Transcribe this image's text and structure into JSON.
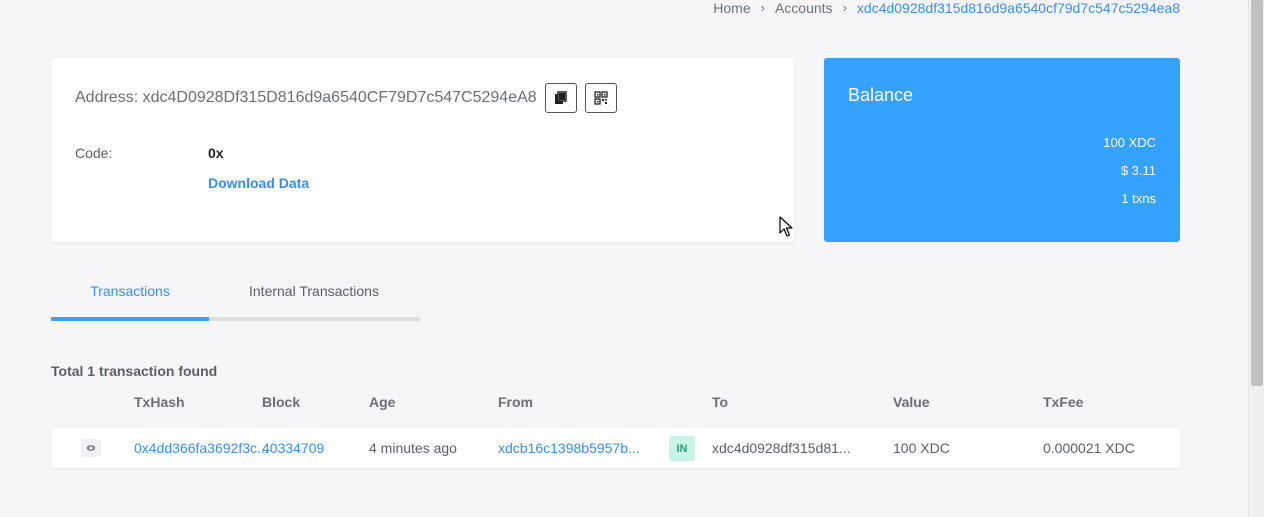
{
  "breadcrumb": {
    "home": "Home",
    "accounts": "Accounts",
    "current": "xdc4d0928df315d816d9a6540cf79d7c547c5294ea8"
  },
  "address_card": {
    "address_text": "Address: xdc4D0928Df315D816d9a6540CF79D7c547C5294eA8",
    "code_label": "Code:",
    "code_value": "0x",
    "download_label": "Download Data"
  },
  "balance": {
    "title": "Balance",
    "xdc": "100 XDC",
    "usd": "$ 3.11",
    "txns": "1 txns"
  },
  "tabs": [
    {
      "label": "Transactions",
      "active": true
    },
    {
      "label": "Internal Transactions",
      "active": false
    }
  ],
  "total_text": "Total 1 transaction found",
  "table": {
    "headers": {
      "txhash": "TxHash",
      "block": "Block",
      "age": "Age",
      "from": "From",
      "to": "To",
      "value": "Value",
      "txfee": "TxFee"
    },
    "rows": [
      {
        "txhash": "0x4dd366fa3692f3c...",
        "block": "40334709",
        "age": "4 minutes ago",
        "from": "xdcb16c1398b5957b...",
        "direction": "IN",
        "to": "xdc4d0928df315d81...",
        "value": "100 XDC",
        "txfee": "0.000021 XDC"
      }
    ]
  },
  "colors": {
    "accent": "#35a2ff",
    "link": "#3a8ee6",
    "badge_bg": "#c8f3e6",
    "badge_text": "#2aa37a"
  },
  "icons": {
    "copy": "copy-icon",
    "qr": "qr-code-icon",
    "eye": "eye-icon"
  }
}
